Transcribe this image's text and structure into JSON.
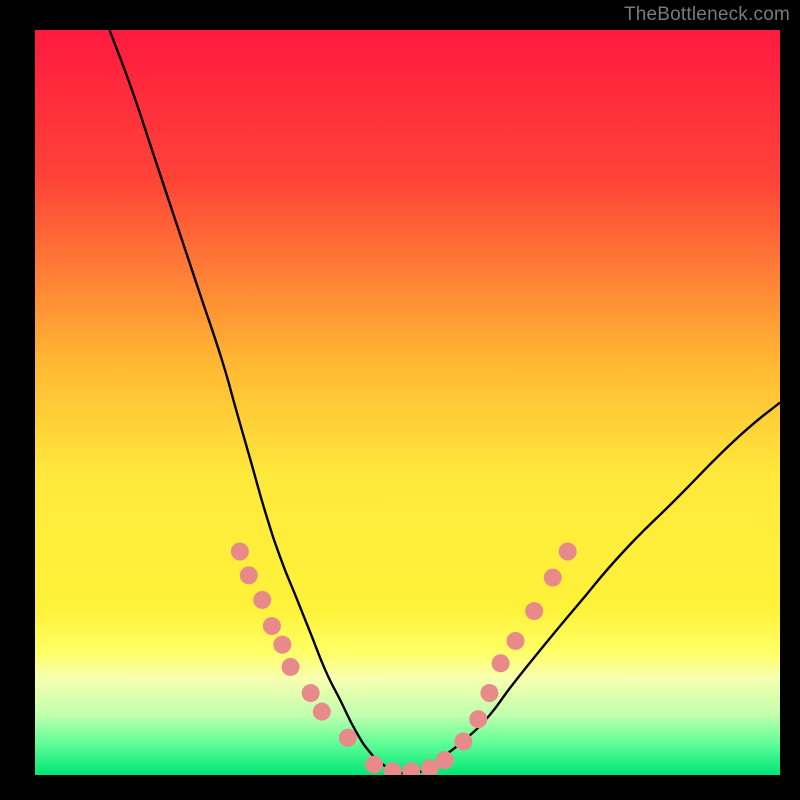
{
  "watermark": "TheBottleneck.com",
  "chart_data": {
    "type": "line",
    "title": "",
    "xlabel": "",
    "ylabel": "",
    "xlim": [
      0,
      100
    ],
    "ylim": [
      0,
      100
    ],
    "background_gradient": {
      "stops": [
        {
          "offset": 0.0,
          "color": "#ff1a3f"
        },
        {
          "offset": 0.2,
          "color": "#ff4338"
        },
        {
          "offset": 0.45,
          "color": "#ffb933"
        },
        {
          "offset": 0.6,
          "color": "#ffe93c"
        },
        {
          "offset": 0.78,
          "color": "#fff23a"
        },
        {
          "offset": 0.835,
          "color": "#ffff66"
        },
        {
          "offset": 0.87,
          "color": "#f8ffb0"
        },
        {
          "offset": 0.92,
          "color": "#bfffad"
        },
        {
          "offset": 0.955,
          "color": "#66ff99"
        },
        {
          "offset": 1.0,
          "color": "#00e676"
        }
      ]
    },
    "series": [
      {
        "name": "curve",
        "color": "#000000",
        "stroke_width": 2.4,
        "x": [
          10,
          13,
          16,
          19,
          22,
          25,
          27,
          29,
          31,
          33,
          35,
          37,
          39,
          41,
          43,
          45,
          47,
          49,
          51,
          53,
          55,
          58,
          61,
          64,
          68,
          73,
          79,
          86,
          94,
          100
        ],
        "y": [
          100,
          92,
          83,
          74,
          65,
          56,
          49,
          42,
          35,
          29,
          24,
          19,
          14,
          10,
          6,
          3,
          1.2,
          0.3,
          0.3,
          1.0,
          2.6,
          5.0,
          8,
          12,
          17,
          23,
          30,
          37,
          45,
          50
        ]
      }
    ],
    "markers": {
      "color": "#e88a8a",
      "radius": 9,
      "points": [
        {
          "x": 27.5,
          "y": 30.0
        },
        {
          "x": 28.7,
          "y": 26.8
        },
        {
          "x": 30.5,
          "y": 23.5
        },
        {
          "x": 31.8,
          "y": 20.0
        },
        {
          "x": 33.2,
          "y": 17.5
        },
        {
          "x": 34.3,
          "y": 14.5
        },
        {
          "x": 37.0,
          "y": 11.0
        },
        {
          "x": 38.5,
          "y": 8.5
        },
        {
          "x": 42.0,
          "y": 5.0
        },
        {
          "x": 45.5,
          "y": 1.4
        },
        {
          "x": 48.0,
          "y": 0.5
        },
        {
          "x": 50.5,
          "y": 0.5
        },
        {
          "x": 53.0,
          "y": 0.9
        },
        {
          "x": 55.0,
          "y": 2.0
        },
        {
          "x": 57.5,
          "y": 4.5
        },
        {
          "x": 59.5,
          "y": 7.5
        },
        {
          "x": 61.0,
          "y": 11.0
        },
        {
          "x": 62.5,
          "y": 15.0
        },
        {
          "x": 64.5,
          "y": 18.0
        },
        {
          "x": 67.0,
          "y": 22.0
        },
        {
          "x": 69.5,
          "y": 26.5
        },
        {
          "x": 71.5,
          "y": 30.0
        }
      ]
    }
  }
}
